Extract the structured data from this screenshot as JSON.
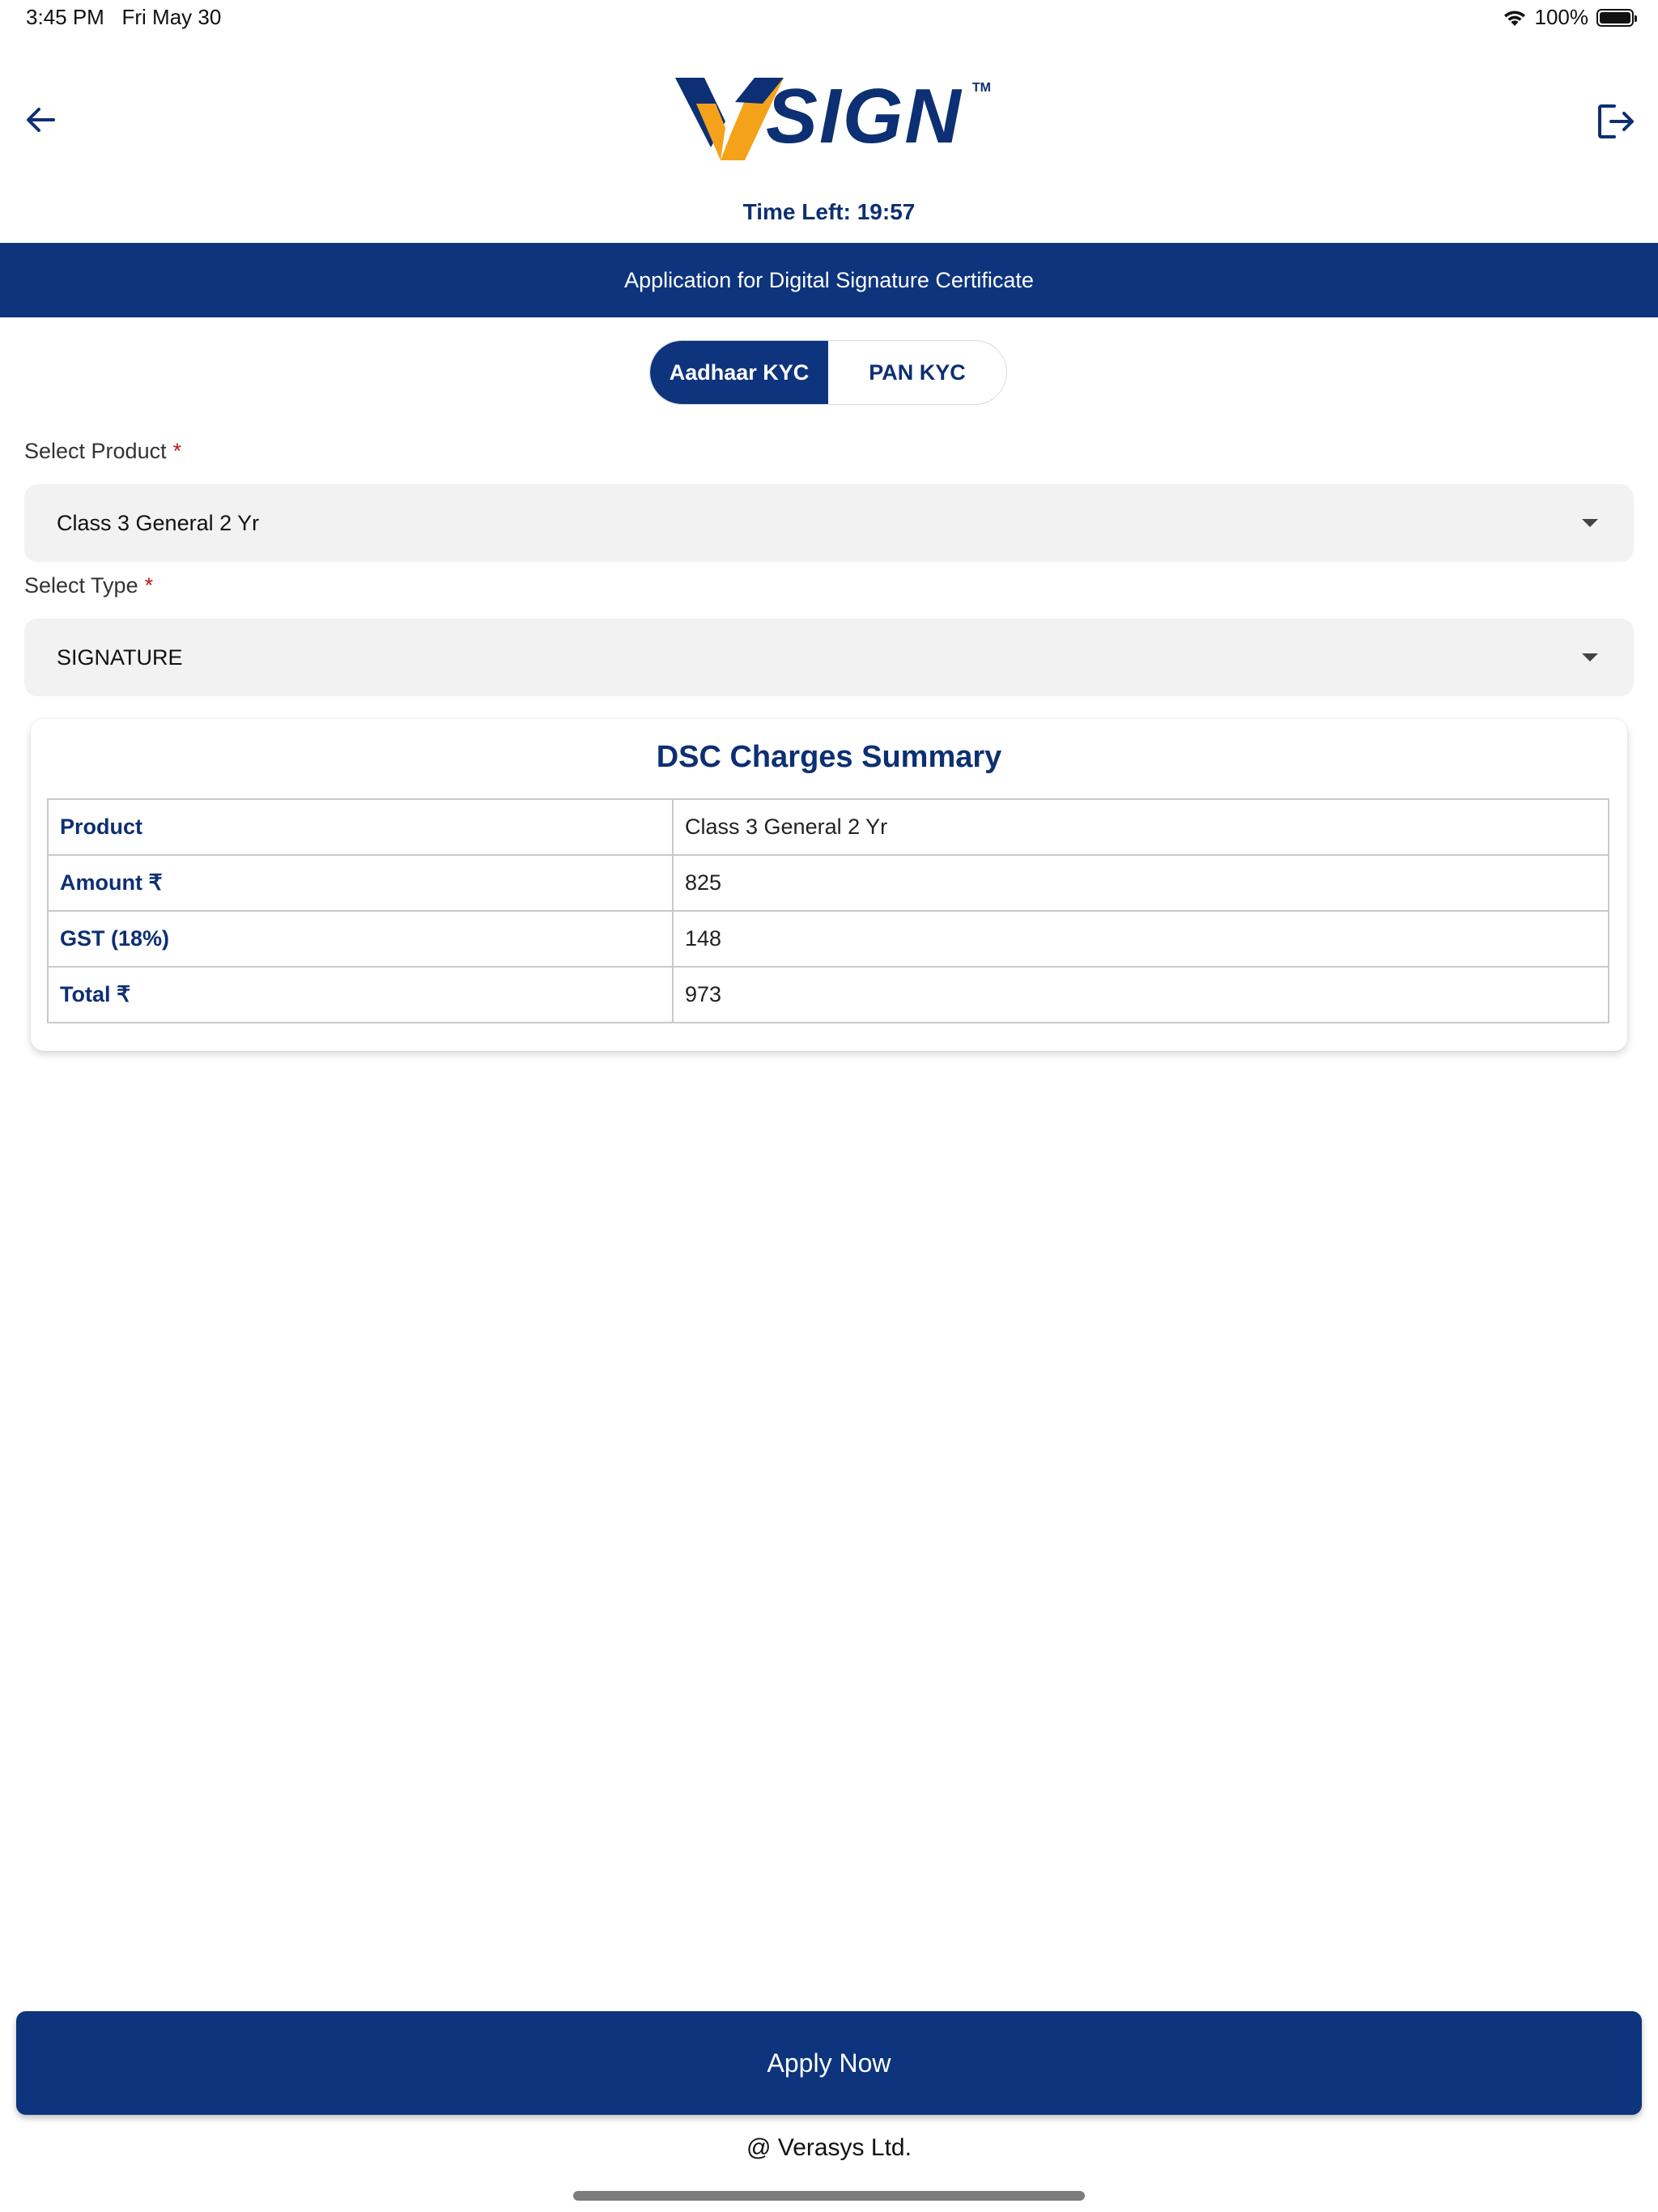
{
  "status_bar": {
    "time": "3:45 PM",
    "date": "Fri May 30",
    "battery": "100%",
    "battery_level": 1.0
  },
  "header": {
    "logo_text": "SIGN",
    "logo_tm": "TM",
    "timer_label": "Time Left:",
    "timer_value": "19:57"
  },
  "title_bar": {
    "text": "Application for Digital Signature Certificate"
  },
  "kyc_tabs": [
    {
      "label": "Aadhaar KYC",
      "active": true
    },
    {
      "label": "PAN KYC",
      "active": false
    }
  ],
  "form": {
    "product": {
      "label": "Select Product",
      "required_mark": "*",
      "value": "Class 3 General 2 Yr"
    },
    "type": {
      "label": "Select Type",
      "required_mark": "*",
      "value": "SIGNATURE"
    }
  },
  "summary": {
    "title": "DSC Charges Summary",
    "rows": [
      {
        "key": "Product",
        "value": "Class 3 General 2 Yr"
      },
      {
        "key": "Amount ₹",
        "value": "825"
      },
      {
        "key": "GST (18%)",
        "value": "148"
      },
      {
        "key": "Total ₹",
        "value": "973"
      }
    ]
  },
  "actions": {
    "apply_label": "Apply Now"
  },
  "footer": {
    "text": "@ Verasys Ltd."
  },
  "colors": {
    "primary": "#0d347d",
    "logo_navy": "#0d2f73",
    "logo_orange": "#f5a21b",
    "required": "#c01818"
  }
}
